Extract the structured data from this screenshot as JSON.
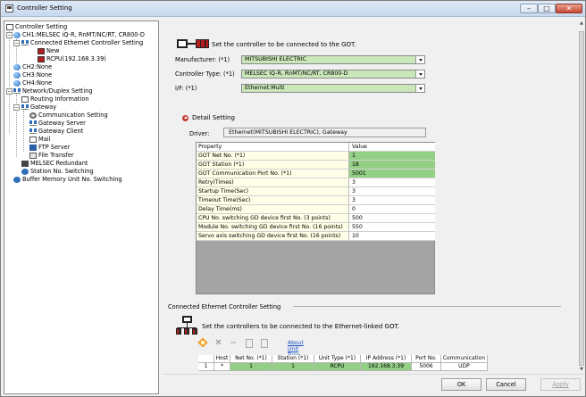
{
  "window": {
    "title": "Controller Setting"
  },
  "tree": {
    "root": "Controller Setting",
    "ch1": "CH1:MELSEC iQ-R, RnMT/NC/RT, CR800-D",
    "connected_eth": "Connected Ethernet Controller Setting",
    "new": "New",
    "rcpu": "RCPU(192.168.3.39)",
    "ch2": "CH2:None",
    "ch3": "CH3:None",
    "ch4": "CH4:None",
    "network": "Network/Duplex Setting",
    "routing": "Routing Information",
    "gateway": "Gateway",
    "comm_setting": "Communication Setting",
    "gateway_server": "Gateway Server",
    "gateway_client": "Gateway Client",
    "mail": "Mail",
    "ftp_server": "FTP Server",
    "file_transfer": "File Transfer",
    "melsec_redundant": "MELSEC Redundant",
    "station_switching": "Station No. Switching",
    "buffer_memory": "Buffer Memory Unit No. Switching"
  },
  "header": {
    "text": "Set the controller to be connected to the GOT."
  },
  "fields": {
    "manufacturer_label": "Manufacturer: (*1)",
    "manufacturer_value": "MITSUBISHI ELECTRIC",
    "controller_type_label": "Controller Type: (*1)",
    "controller_type_value": "MELSEC iQ-R, RnMT/NC/RT, CR800-D",
    "if_label": "I/F: (*1)",
    "if_value": "Ethernet:Multi"
  },
  "detail": {
    "label": "Detail Setting",
    "driver_label": "Driver:",
    "driver_value": "Ethernet(MITSUBISHI ELECTRIC), Gateway"
  },
  "property_table": {
    "col_property": "Property",
    "col_value": "Value",
    "rows": [
      {
        "property": "GOT Net No. (*1)",
        "value": "1"
      },
      {
        "property": "GOT Station (*1)",
        "value": "18"
      },
      {
        "property": "GOT Communication Port No. (*1)",
        "value": "5001"
      },
      {
        "property": "Retry(Times)",
        "value": "3"
      },
      {
        "property": "Startup Time(Sec)",
        "value": "3"
      },
      {
        "property": "Timeout Time(Sec)",
        "value": "3"
      },
      {
        "property": "Delay Time(ms)",
        "value": "0"
      },
      {
        "property": "CPU No. switching GD device first No. (3 points)",
        "value": "500"
      },
      {
        "property": "Module No. switching GD device first No. (16 points)",
        "value": "550"
      },
      {
        "property": "Servo axis switching GD device first No. (16 points)",
        "value": "10"
      }
    ]
  },
  "connected_section": {
    "label": "Connected Ethernet Controller Setting",
    "description": "Set the controllers to be connected to the Ethernet-linked GOT.",
    "about_link": "About Unit Type"
  },
  "unit_table": {
    "headers": [
      "",
      "Host",
      "Net No. (*1)",
      "Station (*1)",
      "Unit Type (*1)",
      "IP Address (*1)",
      "Port No.",
      "Communication"
    ],
    "rows": [
      [
        "1",
        "*",
        "1",
        "1",
        "RCPU",
        "192.168.3.39",
        "5006",
        "UDP"
      ]
    ]
  },
  "buttons": {
    "ok": "OK",
    "cancel": "Cancel",
    "apply": "Apply"
  },
  "colors": {
    "required_green": "#93cf85",
    "field_green": "#c9e7b8",
    "link_blue": "#1a4fc4"
  }
}
